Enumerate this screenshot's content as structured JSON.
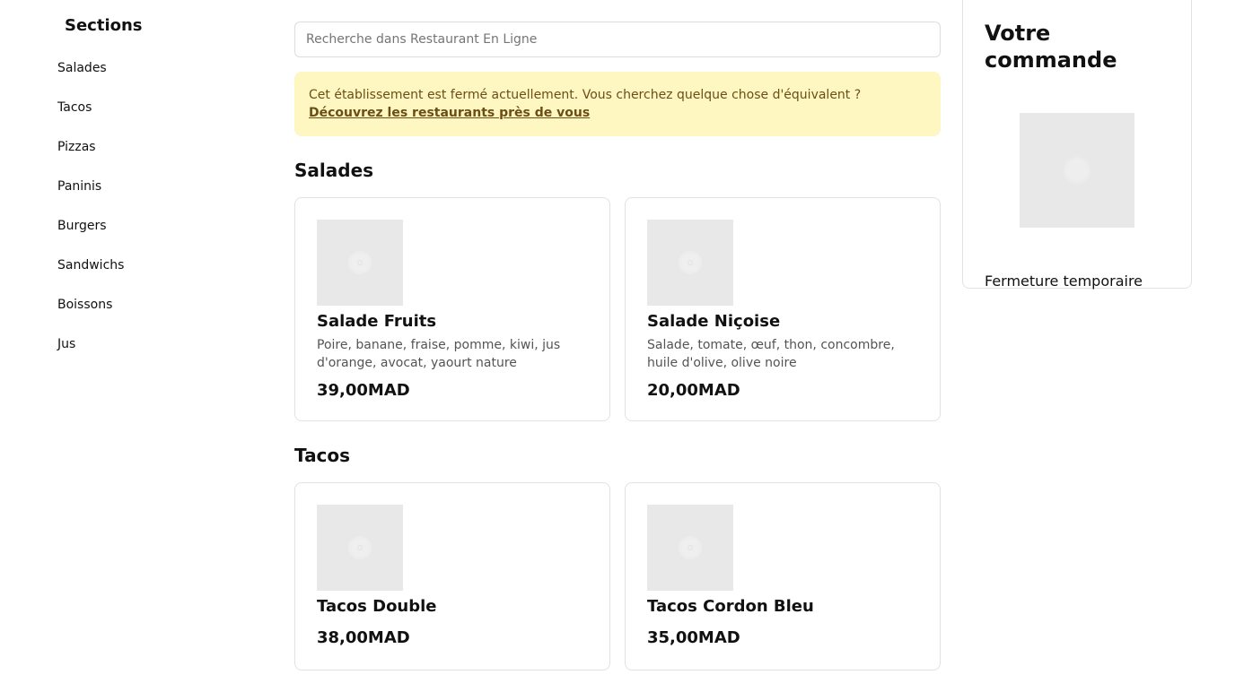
{
  "sidebar": {
    "title": "Sections",
    "items": [
      {
        "label": "Salades"
      },
      {
        "label": "Tacos"
      },
      {
        "label": "Pizzas"
      },
      {
        "label": "Paninis"
      },
      {
        "label": "Burgers"
      },
      {
        "label": "Sandwichs"
      },
      {
        "label": "Boissons"
      },
      {
        "label": "Jus"
      }
    ]
  },
  "search": {
    "placeholder": "Recherche dans Restaurant En Ligne",
    "value": ""
  },
  "alert": {
    "message": "Cet établissement est fermé actuellement. Vous cherchez quelque chose d'équivalent ?",
    "link_label": "Découvrez les restaurants près de vous",
    "background_color": "#fff7c2",
    "text_color": "#6b4e16"
  },
  "sections": [
    {
      "title": "Salades",
      "items": [
        {
          "name": "Salade Fruits",
          "description": "Poire, banane, fraise, pomme, kiwi, jus d'orange, avocat, yaourt nature",
          "price": "39,00MAD",
          "image_icon": "image-placeholder-icon"
        },
        {
          "name": "Salade Niçoise",
          "description": "Salade, tomate, œuf, thon, concombre, huile d'olive, olive noire",
          "price": "20,00MAD",
          "image_icon": "image-placeholder-icon"
        }
      ]
    },
    {
      "title": "Tacos",
      "items": [
        {
          "name": "Tacos Double",
          "description": "",
          "price": "38,00MAD",
          "image_icon": "image-placeholder-icon"
        },
        {
          "name": "Tacos Cordon Bleu",
          "description": "",
          "price": "35,00MAD",
          "image_icon": "image-placeholder-icon"
        }
      ]
    }
  ],
  "order": {
    "title": "Votre commande",
    "status": "Fermeture temporaire",
    "image_icon": "empty-cart-placeholder-icon"
  }
}
